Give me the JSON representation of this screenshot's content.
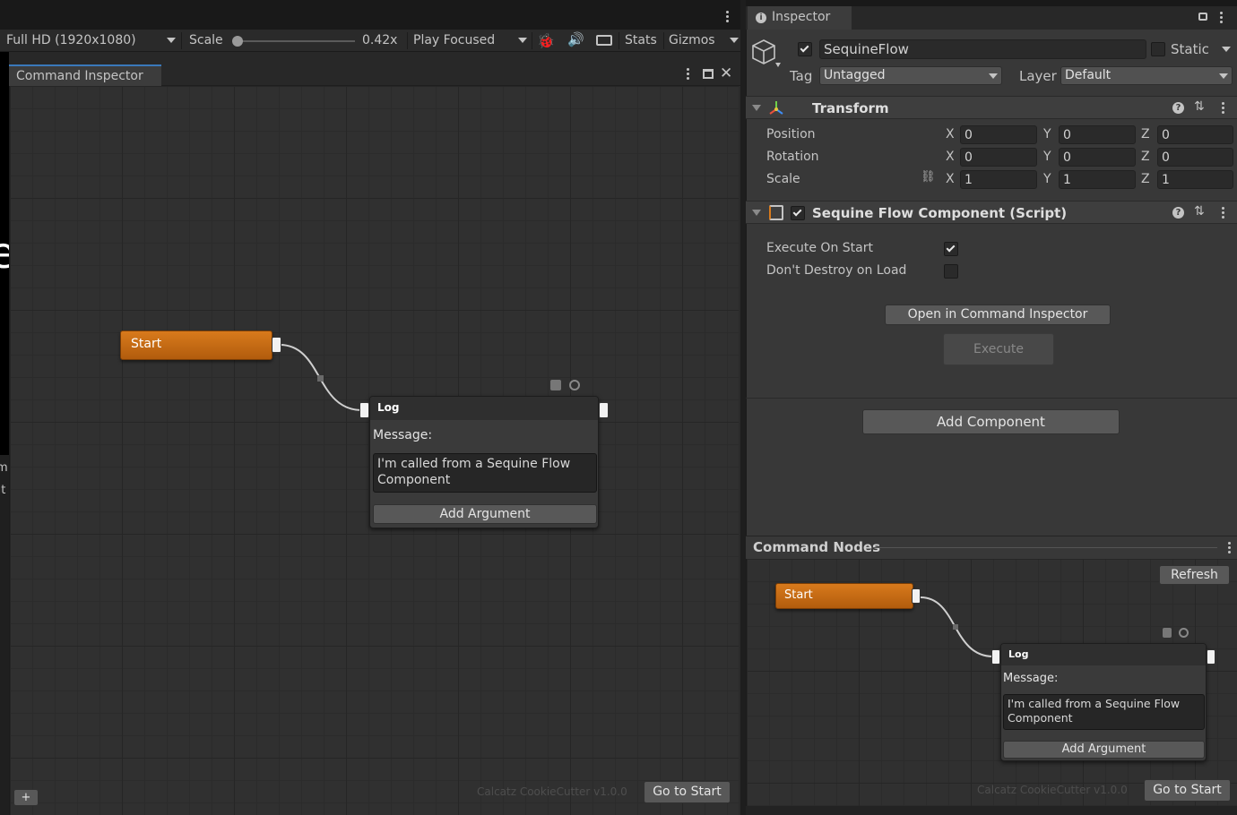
{
  "game_toolbar": {
    "resolution": "Full HD (1920x1080)",
    "scale_label": "Scale",
    "scale_value": "0.42x",
    "play_mode": "Play Focused",
    "stats": "Stats",
    "gizmos": "Gizmos",
    "scale_fraction": 0.0
  },
  "game_view_fragments": {
    "big_letter": "e",
    "side_1": "m",
    "side_2": "lit"
  },
  "command_inspector": {
    "tab_title": "Command Inspector",
    "start_node": "Start",
    "log_node": {
      "title": "Log",
      "message_label": "Message:",
      "message_value": "I'm called from a Sequine Flow Component",
      "add_argument": "Add Argument"
    },
    "watermark": "Calcatz CookieCutter v1.0.0",
    "go_to_start": "Go to Start",
    "add_button": "+"
  },
  "inspector": {
    "tab_title": "Inspector",
    "object_name": "SequineFlow",
    "static_label": "Static",
    "tag_label": "Tag",
    "tag_value": "Untagged",
    "layer_label": "Layer",
    "layer_value": "Default",
    "transform": {
      "title": "Transform",
      "rows": [
        {
          "label": "Position",
          "x": "0",
          "y": "0",
          "z": "0"
        },
        {
          "label": "Rotation",
          "x": "0",
          "y": "0",
          "z": "0"
        },
        {
          "label": "Scale",
          "x": "1",
          "y": "1",
          "z": "1"
        }
      ],
      "axis_x": "X",
      "axis_y": "Y",
      "axis_z": "Z"
    },
    "component": {
      "title": "Sequine Flow Component (Script)",
      "execute_on_start_label": "Execute On Start",
      "execute_on_start": true,
      "dont_destroy_label": "Don't Destroy on Load",
      "dont_destroy": false,
      "open_button": "Open in Command Inspector",
      "execute_button": "Execute"
    },
    "add_component": "Add Component"
  },
  "command_nodes": {
    "title": "Command Nodes",
    "refresh": "Refresh",
    "start_node": "Start",
    "log_node": {
      "title": "Log",
      "message_label": "Message:",
      "message_value": "I'm called from a Sequine Flow Component",
      "add_argument": "Add Argument"
    },
    "watermark": "Calcatz CookieCutter v1.0.0",
    "go_to_start": "Go to Start"
  },
  "colors": {
    "start_node": "#c86b14",
    "tab_accent": "#3a79bb",
    "panel_bg": "#383838",
    "canvas_bg": "#303030"
  },
  "icons": [
    "bug-icon",
    "audio-icon",
    "keyboard-icon",
    "cube-icon",
    "transform-axes-icon",
    "script-icon",
    "help-icon",
    "preset-icon",
    "link-scale-icon",
    "info-icon",
    "lock-icon"
  ]
}
